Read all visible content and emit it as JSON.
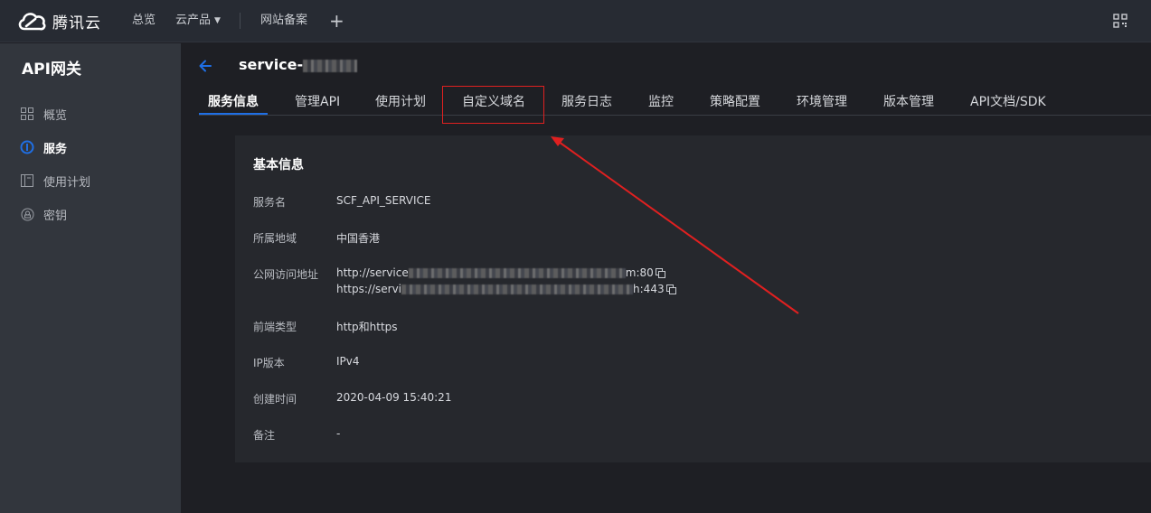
{
  "topbar": {
    "brand": "腾讯云",
    "nav": [
      "总览",
      "云产品",
      "网站备案"
    ],
    "plus": "+"
  },
  "sidebar": {
    "title": "API网关",
    "items": [
      {
        "label": "概览",
        "icon": "grid-icon",
        "active": false
      },
      {
        "label": "服务",
        "icon": "service-icon",
        "active": true
      },
      {
        "label": "使用计划",
        "icon": "plan-icon",
        "active": false
      },
      {
        "label": "密钥",
        "icon": "key-icon",
        "active": false
      }
    ]
  },
  "main": {
    "service_title": "service-",
    "tabs": [
      "服务信息",
      "管理API",
      "使用计划",
      "自定义域名",
      "服务日志",
      "监控",
      "策略配置",
      "环境管理",
      "版本管理",
      "API文档/SDK"
    ],
    "active_tab": "服务信息",
    "highlighted_tab": "自定义域名"
  },
  "basic_info": {
    "title": "基本信息",
    "rows": [
      {
        "label": "服务名",
        "value": "SCF_API_SERVICE"
      },
      {
        "label": "所属地域",
        "value": "中国香港"
      },
      {
        "label": "公网访问地址",
        "value_line1_start": "http://service",
        "value_line1_end": "m:80",
        "value_line2_start": "https://servi",
        "value_line2_end": "h:443"
      },
      {
        "label": "前端类型",
        "value": "http和https"
      },
      {
        "label": "IP版本",
        "value": "IPv4"
      },
      {
        "label": "创建时间",
        "value": "2020-04-09 15:40:21"
      },
      {
        "label": "备注",
        "value": "-"
      }
    ]
  },
  "colors": {
    "accent": "#1f6fe5",
    "annotation_red": "#e02020",
    "sidebar_bg": "#32363d",
    "topbar_bg": "#272b33",
    "card_bg": "#26282d"
  }
}
